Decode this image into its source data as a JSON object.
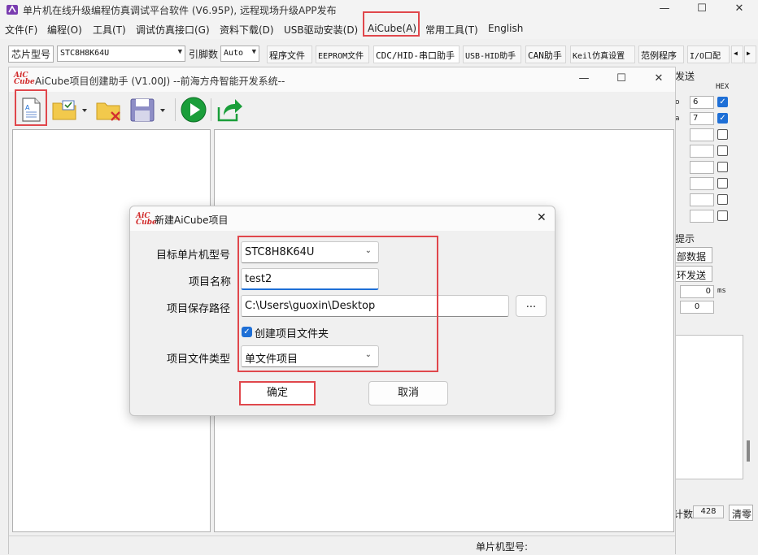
{
  "app": {
    "title": "单片机在线升级编程仿真调试平台软件 (V6.95P), 远程现场升级APP发布",
    "minimize": "—",
    "maximize": "☐",
    "close": "✕"
  },
  "menu": [
    "文件(F)",
    "编程(O)",
    "工具(T)",
    "调试仿真接口(G)",
    "资料下载(D)",
    "USB驱动安装(D)",
    "AiCube(A)",
    "常用工具(T)",
    "English"
  ],
  "toolbar": {
    "chip_label": "芯片型号",
    "chip_value": "STC8H8K64U",
    "pins_label": "引脚数",
    "pins_value": "Auto",
    "tabs": [
      "程序文件",
      "EEPROM文件",
      "CDC/HID-串口助手",
      "USB-HID助手",
      "CAN助手",
      "Keil仿真设置",
      "范例程序",
      "I/O口配"
    ],
    "scroll_left": "◀",
    "scroll_right": "▶"
  },
  "right_panel": {
    "header_send": "发送",
    "header_hex": "HEX",
    "row1_prefix": "o",
    "row1_value": "6",
    "row2_prefix": "a",
    "row2_value": "7",
    "hint": "提示",
    "btn_all_data": "部数据",
    "btn_loop_send": "环发送",
    "interval_value": "0",
    "interval_unit": "ms",
    "count_value": "0",
    "count_label": "计数",
    "count_num": "428",
    "clear": "清零"
  },
  "helper": {
    "title": "AiCube项目创建助手 (V1.00J) --前海方舟智能开发系统--",
    "logo_top": "AiC",
    "logo_bottom": "Cube",
    "minimize": "—",
    "maximize": "☐",
    "close": "✕",
    "status_chip": "单片机型号:"
  },
  "dialog": {
    "title": "新建AiCube项目",
    "close": "✕",
    "mcu_label": "目标单片机型号",
    "mcu_value": "STC8H8K64U",
    "name_label": "项目名称",
    "name_value": "test2",
    "path_label": "项目保存路径",
    "path_value": "C:\\Users\\guoxin\\Desktop",
    "browse": "...",
    "create_folder": "创建项目文件夹",
    "create_folder_checked": true,
    "type_label": "项目文件类型",
    "type_value": "单文件项目",
    "ok": "确定",
    "cancel": "取消"
  },
  "colors": {
    "highlight": "#e0474c",
    "accent": "#1e6fd6"
  }
}
